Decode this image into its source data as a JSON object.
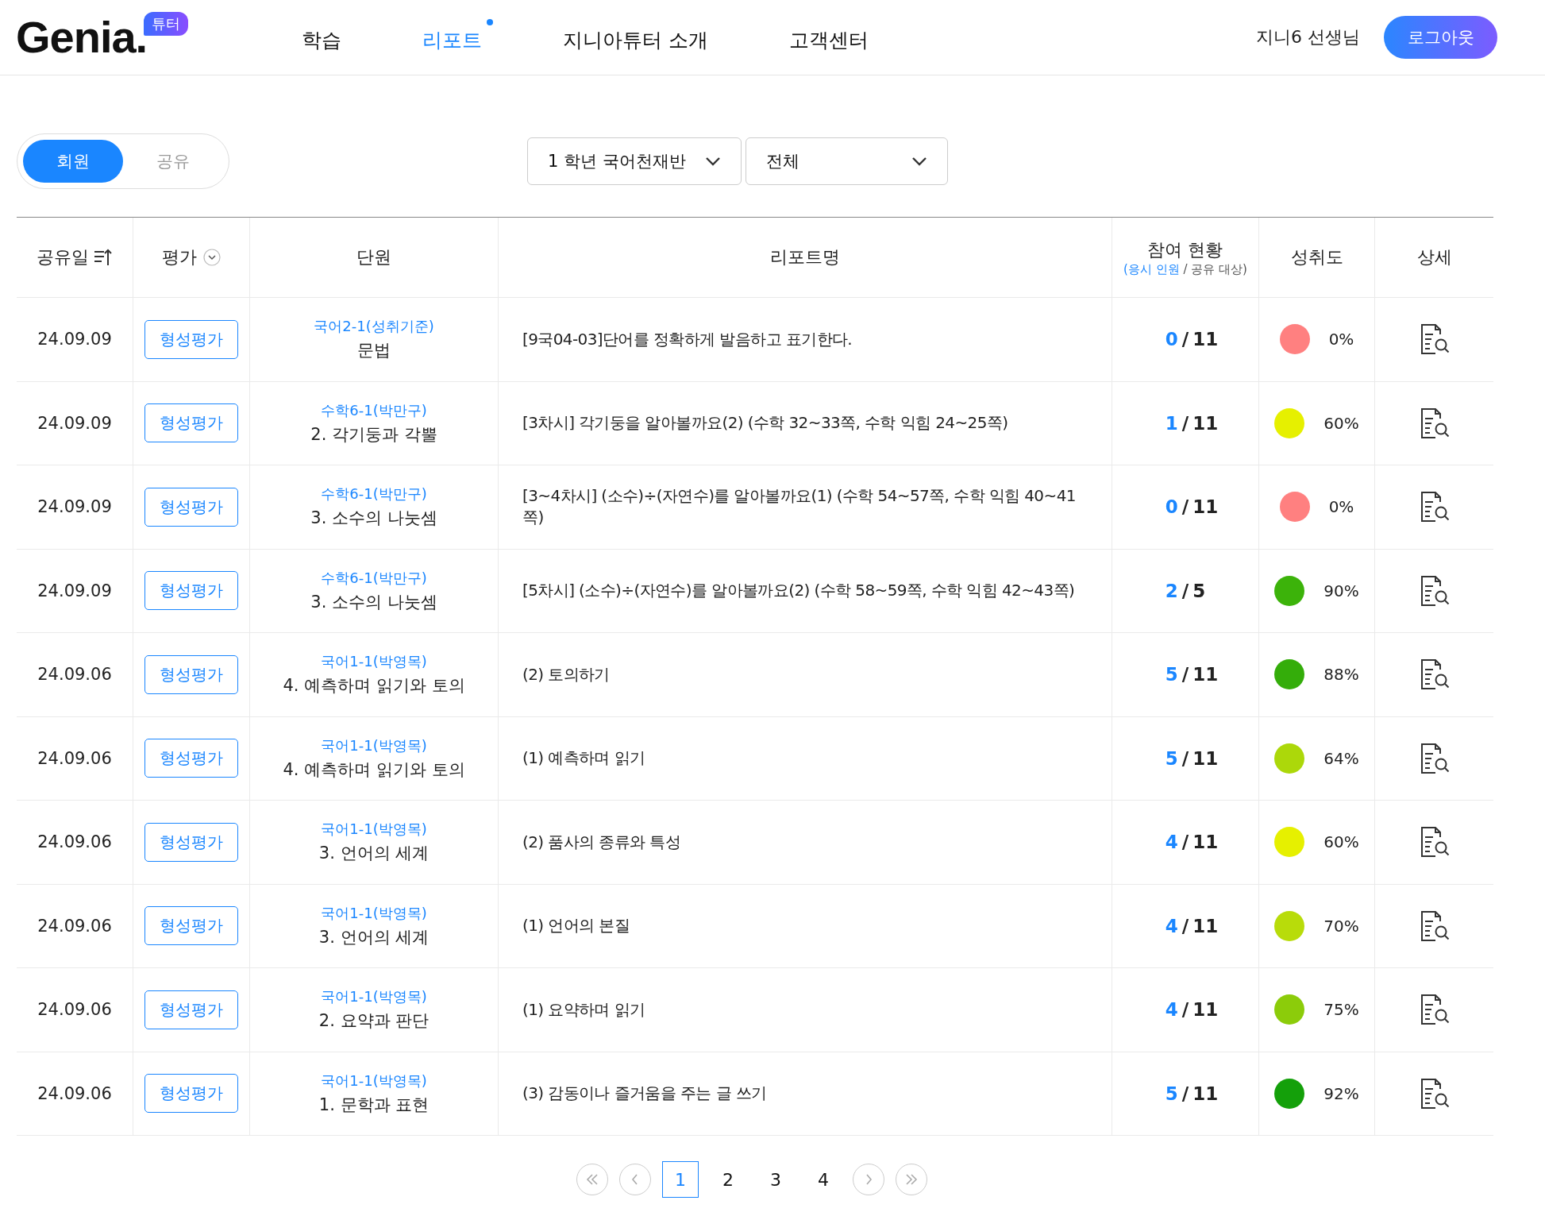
{
  "header": {
    "logo": "Genia.",
    "logo_badge": "튜터",
    "nav": [
      {
        "label": "학습",
        "selected": false
      },
      {
        "label": "리포트",
        "selected": true
      },
      {
        "label": "지니아튜터 소개",
        "selected": false
      },
      {
        "label": "고객센터",
        "selected": false
      }
    ],
    "user": "지니6 선생님",
    "logout": "로그아웃"
  },
  "toggle": [
    {
      "label": "회원",
      "selected": true
    },
    {
      "label": "공유",
      "selected": false
    }
  ],
  "filters": [
    {
      "value": "1 학년 국어천재반"
    },
    {
      "value": "전체"
    }
  ],
  "table": {
    "columns": [
      {
        "kind": "sort",
        "label": "공유일"
      },
      {
        "kind": "dropdown",
        "label": "평가"
      },
      {
        "kind": "plain",
        "label": "단원"
      },
      {
        "kind": "plain",
        "label": "리포트명"
      },
      {
        "kind": "sub",
        "label": "참여 현황",
        "sub_highlight": "(응시 인원",
        "sub_rest": "/ 공유 대상)"
      },
      {
        "kind": "plain",
        "label": "성취도"
      },
      {
        "kind": "plain",
        "label": "상세"
      }
    ],
    "rows": [
      {
        "date": "24.09.09",
        "type": "형성평가",
        "book": "국어2-1(성취기준)",
        "unit": "문법",
        "report": "[9국04-03]단어를 정확하게 발음하고 표기한다.",
        "taken": "0",
        "separator": "/",
        "total": "11",
        "color": "#ff8080",
        "achievement": "0%"
      },
      {
        "date": "24.09.09",
        "type": "형성평가",
        "book": "수학6-1(박만구)",
        "unit": "2. 각기둥과 각뿔",
        "report": "[3차시] 각기둥을 알아볼까요(2) (수학 32~33쪽, 수학 익힘 24~25쪽)",
        "taken": "1",
        "separator": "/",
        "total": "11",
        "color": "#e6f000",
        "achievement": "60%"
      },
      {
        "date": "24.09.09",
        "type": "형성평가",
        "book": "수학6-1(박만구)",
        "unit": "3. 소수의 나눗셈",
        "report": "[3~4차시] (소수)÷(자연수)를 알아볼까요(1) (수학 54~57쪽, 수학 익힘 40~41쪽)",
        "taken": "0",
        "separator": "/",
        "total": "11",
        "color": "#ff8080",
        "achievement": "0%"
      },
      {
        "date": "24.09.09",
        "type": "형성평가",
        "book": "수학6-1(박만구)",
        "unit": "3. 소수의 나눗셈",
        "report": "[5차시] (소수)÷(자연수)를 알아볼까요(2) (수학 58~59쪽, 수학 익힘 42~43쪽)",
        "taken": "2",
        "separator": "/",
        "total": "5",
        "color": "#3cb30a",
        "achievement": "90%"
      },
      {
        "date": "24.09.06",
        "type": "형성평가",
        "book": "국어1-1(박영목)",
        "unit": "4. 예측하며 읽기와 토의",
        "report": "(2) 토의하기",
        "taken": "5",
        "separator": "/",
        "total": "11",
        "color": "#34ad0a",
        "achievement": "88%"
      },
      {
        "date": "24.09.06",
        "type": "형성평가",
        "book": "국어1-1(박영목)",
        "unit": "4. 예측하며 읽기와 토의",
        "report": "(1) 예측하며 읽기",
        "taken": "5",
        "separator": "/",
        "total": "11",
        "color": "#acd80a",
        "achievement": "64%"
      },
      {
        "date": "24.09.06",
        "type": "형성평가",
        "book": "국어1-1(박영목)",
        "unit": "3. 언어의 세계",
        "report": "(2) 품사의 종류와 특성",
        "taken": "4",
        "separator": "/",
        "total": "11",
        "color": "#e6f000",
        "achievement": "60%"
      },
      {
        "date": "24.09.06",
        "type": "형성평가",
        "book": "국어1-1(박영목)",
        "unit": "3. 언어의 세계",
        "report": "(1) 언어의 본질",
        "taken": "4",
        "separator": "/",
        "total": "11",
        "color": "#b8dc0a",
        "achievement": "70%"
      },
      {
        "date": "24.09.06",
        "type": "형성평가",
        "book": "국어1-1(박영목)",
        "unit": "2. 요약과 판단",
        "report": "(1) 요약하며 읽기",
        "taken": "4",
        "separator": "/",
        "total": "11",
        "color": "#8ccc0a",
        "achievement": "75%"
      },
      {
        "date": "24.09.06",
        "type": "형성평가",
        "book": "국어1-1(박영목)",
        "unit": "1. 문학과 표현",
        "report": "(3) 감동이나 즐거움을 주는 글 쓰기",
        "taken": "5",
        "separator": "/",
        "total": "11",
        "color": "#14a00a",
        "achievement": "92%"
      }
    ]
  },
  "pagination": [
    {
      "label": "1",
      "selected": true
    },
    {
      "label": "2",
      "selected": false
    },
    {
      "label": "3",
      "selected": false
    },
    {
      "label": "4",
      "selected": false
    }
  ]
}
